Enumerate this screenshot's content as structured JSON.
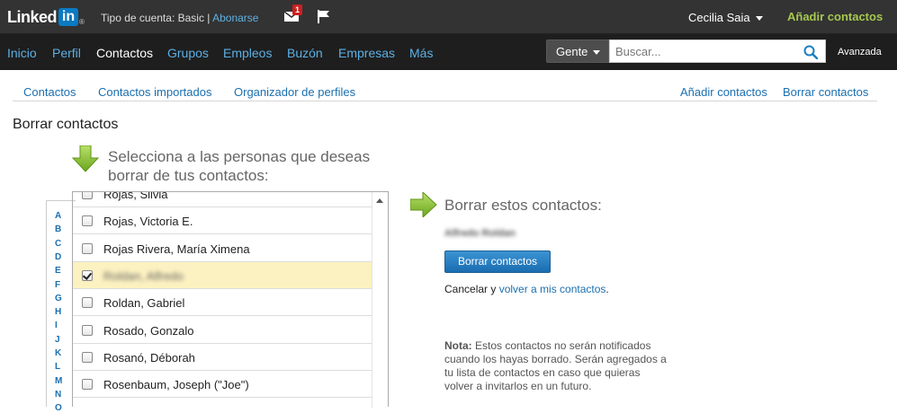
{
  "topbar": {
    "logo_text": "Linked",
    "logo_in": "in",
    "logo_reg": "®",
    "account_label": "Tipo de cuenta: Basic",
    "account_sep": " | ",
    "upgrade_link": "Abonarse",
    "mail_badge": "1",
    "user_name": "Cecilia Saia",
    "add_contacts": "Añadir contactos"
  },
  "nav": {
    "items": [
      "Inicio",
      "Perfil",
      "Contactos",
      "Grupos",
      "Empleos",
      "Buzón",
      "Empresas",
      "Más"
    ],
    "active": "Contactos",
    "search_scope": "Gente",
    "search_placeholder": "Buscar...",
    "advanced": "Avanzada"
  },
  "subnav": {
    "left": [
      "Contactos",
      "Contactos importados",
      "Organizador de perfiles"
    ],
    "right": [
      "Añadir contactos",
      "Borrar contactos"
    ]
  },
  "page_title": "Borrar contactos",
  "instruction_line1": "Selecciona a las personas que deseas",
  "instruction_line2": "borrar de tus contactos:",
  "alphabet": [
    "A",
    "B",
    "C",
    "D",
    "E",
    "F",
    "G",
    "H",
    "I",
    "J",
    "K",
    "L",
    "M",
    "N",
    "O"
  ],
  "contacts": [
    {
      "name": "Rojas, Silvia",
      "checked": false,
      "blurred": false
    },
    {
      "name": "Rojas, Victoria E.",
      "checked": false,
      "blurred": false
    },
    {
      "name": "Rojas Rivera, María Ximena",
      "checked": false,
      "blurred": false
    },
    {
      "name": "Roldan, Alfredo",
      "checked": true,
      "blurred": true
    },
    {
      "name": "Roldan, Gabriel",
      "checked": false,
      "blurred": false
    },
    {
      "name": "Rosado, Gonzalo",
      "checked": false,
      "blurred": false
    },
    {
      "name": "Rosanó, Déborah",
      "checked": false,
      "blurred": false
    },
    {
      "name": "Rosenbaum, Joseph (\"Joe\")",
      "checked": false,
      "blurred": false
    }
  ],
  "right": {
    "title": "Borrar estos contactos:",
    "selected_name": "Alfredo Roldan",
    "delete_button": "Borrar contactos",
    "cancel_prefix": "Cancelar",
    "cancel_mid": " y ",
    "back_link": "volver a mis contactos",
    "cancel_suffix": ".",
    "note_label": "Nota:",
    "note_text": " Estos contactos no serán notificados cuando los hayas borrado. Serán agregados a tu lista de contactos en caso que quieras volver a invitarlos en un futuro."
  },
  "colors": {
    "link": "#1a6fb0",
    "nav_link": "#5cb0e5",
    "accent_green": "#a6c84f",
    "selected_row": "#fcf1c0",
    "button": "#2a82c4"
  }
}
